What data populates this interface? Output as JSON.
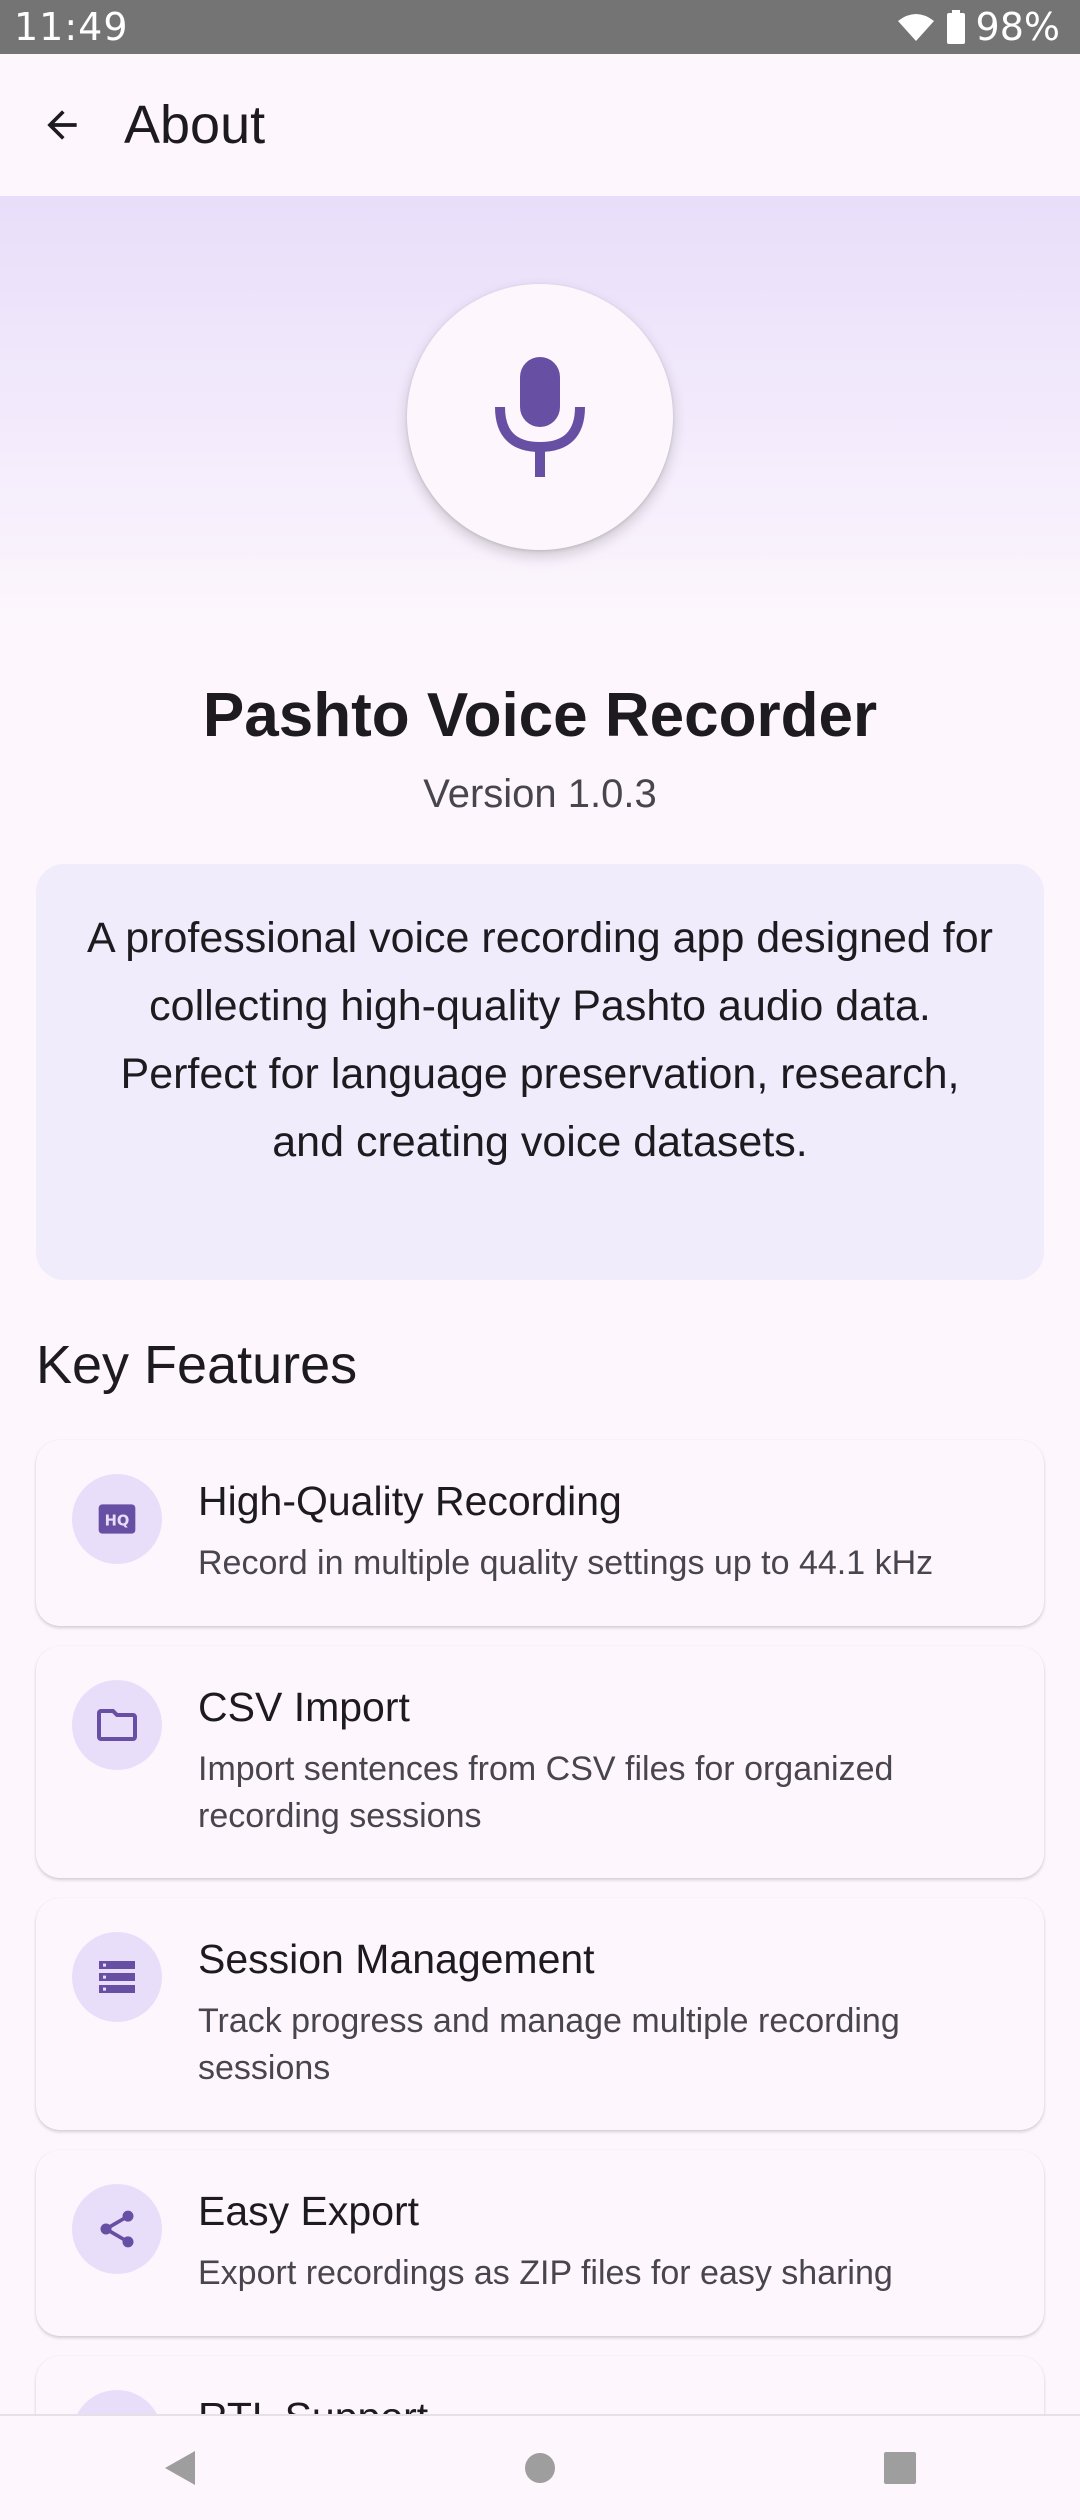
{
  "status_bar": {
    "time": "11:49",
    "battery": "98%"
  },
  "app_bar": {
    "title": "About"
  },
  "app": {
    "name": "Pashto Voice Recorder",
    "version": "Version 1.0.3",
    "description": "A professional voice recording app designed for collecting high-quality Pashto audio data. Perfect for language preservation, research, and creating voice datasets."
  },
  "features_section": {
    "title": "Key Features",
    "items": [
      {
        "title": "High-Quality Recording",
        "desc": "Record in multiple quality settings up to 44.1 kHz",
        "icon": "hq-icon"
      },
      {
        "title": "CSV Import",
        "desc": "Import sentences from CSV files for organized recording sessions",
        "icon": "folder-icon"
      },
      {
        "title": "Session Management",
        "desc": "Track progress and manage multiple recording sessions",
        "icon": "list-icon"
      },
      {
        "title": "Easy Export",
        "desc": "Export recordings as ZIP files for easy sharing",
        "icon": "share-icon"
      },
      {
        "title": "RTL Support",
        "desc": "",
        "icon": "language-icon"
      }
    ]
  },
  "colors": {
    "accent": "#6750a4",
    "container": "#e8defa",
    "background": "#fdf7fd"
  }
}
